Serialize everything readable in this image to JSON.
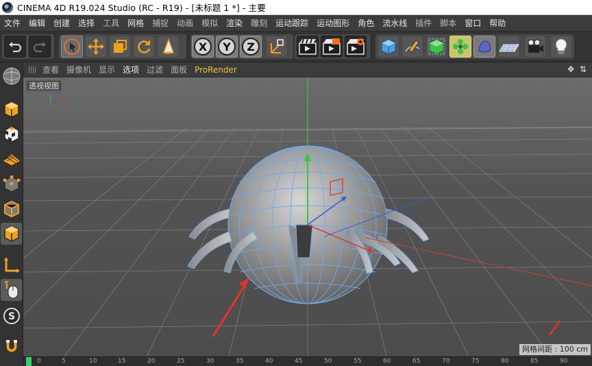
{
  "window": {
    "title": "CINEMA 4D R19.024 Studio (RC - R19) - [未标题 1 *] - 主要"
  },
  "menubar": {
    "items": [
      "文件",
      "编辑",
      "创建",
      "选择",
      "工具",
      "网格",
      "捕捉",
      "动画",
      "模拟",
      "渲染",
      "雕刻",
      "运动跟踪",
      "运动图形",
      "角色",
      "流水线",
      "插件",
      "脚本",
      "窗口",
      "帮助"
    ]
  },
  "toolbar": {
    "icons": [
      "undo-icon",
      "redo-icon",
      "live-select-icon",
      "move-icon",
      "scale-icon",
      "rotate-icon",
      "recent-tools-icon",
      "x-axis-icon",
      "y-axis-icon",
      "z-axis-icon",
      "coordinate-system-icon",
      "render-view-icon",
      "render-picture-viewer-icon",
      "render-settings-icon",
      "cube-icon",
      "pen-spline-icon",
      "subdivision-surface-icon",
      "cloner-icon",
      "deformer-icon",
      "floor-icon",
      "camera-icon",
      "light-icon"
    ],
    "axis_x": "X",
    "axis_y": "Y",
    "axis_z": "Z"
  },
  "leftbar": {
    "icons": [
      "make-editable-icon",
      "model-mode-icon",
      "texture-mode-icon",
      "workplane-icon",
      "points-mode-icon",
      "edges-mode-icon",
      "polygons-mode-icon",
      "axis-mode-icon",
      "tweak-mode-icon",
      "snapping-icon",
      "magnet-icon"
    ]
  },
  "viewport_header": {
    "menus": [
      "查看",
      "摄像机",
      "显示",
      "选项",
      "过滤",
      "面板",
      "ProRender"
    ],
    "active_menu": "选项"
  },
  "viewport": {
    "label": "透视视图",
    "status": "网格间距 : 100 cm",
    "axis_labels": {
      "y": "Y",
      "z": "Z"
    }
  },
  "timeline": {
    "ticks": [
      "0",
      "5",
      "10",
      "15",
      "20",
      "25",
      "30",
      "35",
      "40",
      "45",
      "50",
      "55",
      "60",
      "65",
      "70",
      "75",
      "80",
      "85",
      "90"
    ]
  },
  "colors": {
    "wire": "#6fa8e8",
    "annotation_arrow": "#e8332a",
    "axis_x": "#d83a3a",
    "axis_y": "#3ac83a",
    "axis_z": "#3a5ad8",
    "prorender": "#f0c23c"
  }
}
